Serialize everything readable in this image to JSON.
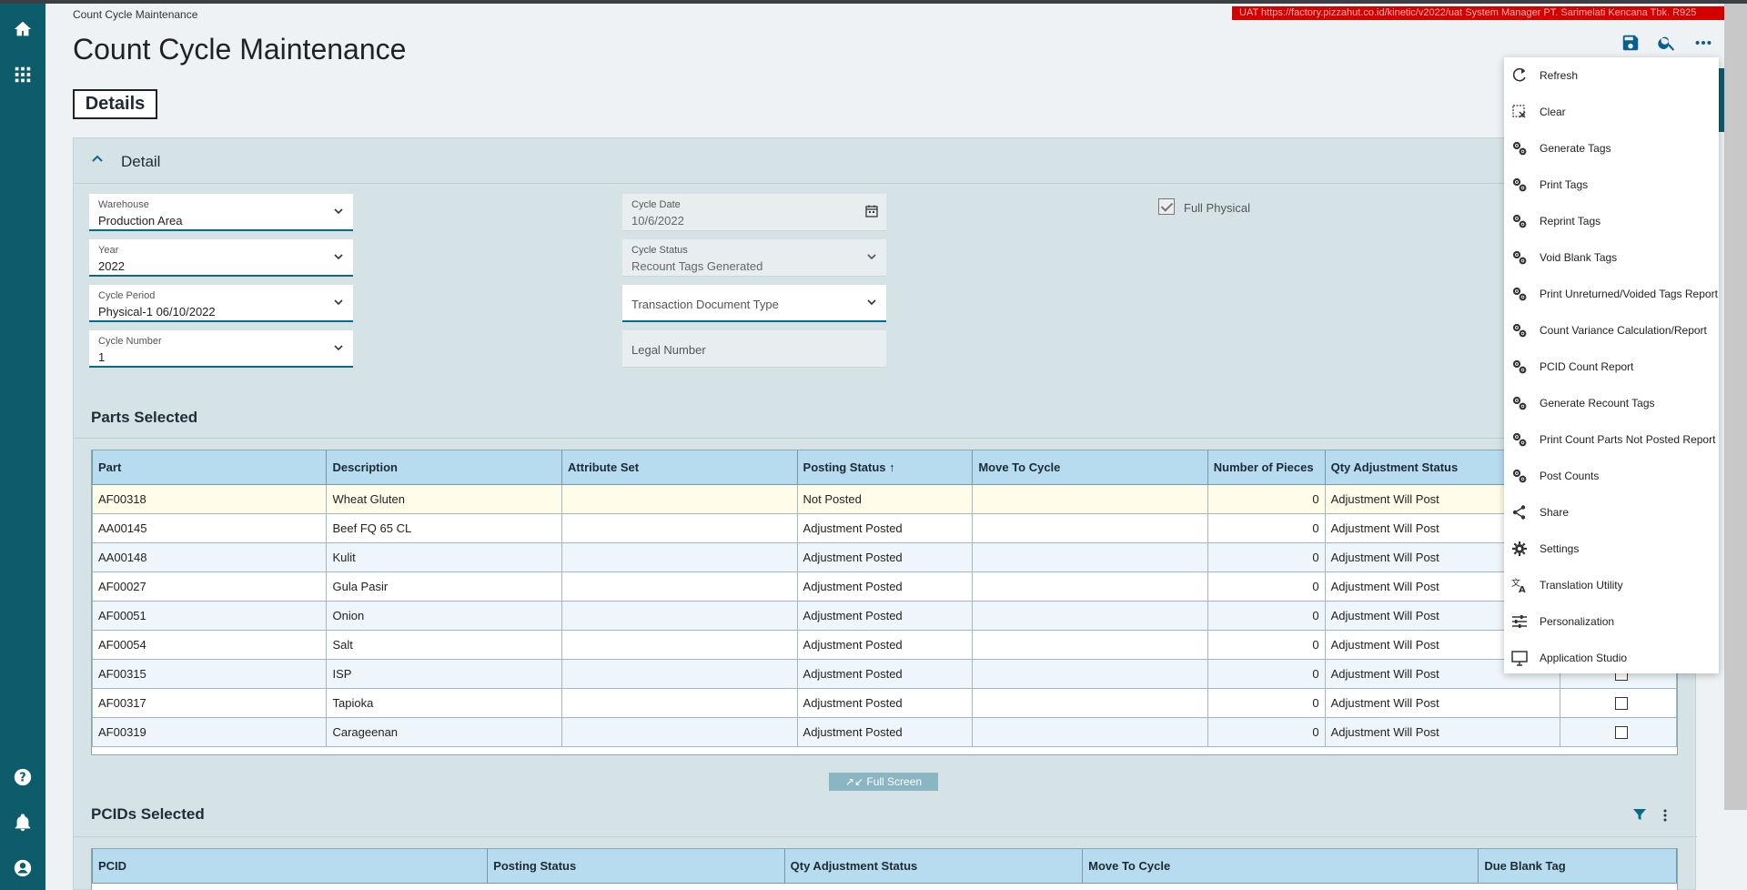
{
  "breadcrumb": "Count Cycle Maintenance",
  "env_banner": "UAT   https://factory.pizzahut.co.id/kinetic/v2022/uat   System Manager   PT. Sarimelati Kencana Tbk.   R925",
  "page_title": "Count Cycle Maintenance",
  "details_tab": "Details",
  "detail": {
    "title": "Detail",
    "warehouse": {
      "label": "Warehouse",
      "value": "Production Area"
    },
    "year": {
      "label": "Year",
      "value": "2022"
    },
    "cycle_period": {
      "label": "Cycle Period",
      "value": "Physical-1 06/10/2022"
    },
    "cycle_number": {
      "label": "Cycle Number",
      "value": "1"
    },
    "cycle_date": {
      "label": "Cycle Date",
      "value": "10/6/2022"
    },
    "cycle_status": {
      "label": "Cycle Status",
      "value": "Recount Tags Generated"
    },
    "transaction_doc_type": {
      "placeholder": "Transaction Document Type"
    },
    "legal_number": {
      "placeholder": "Legal Number"
    },
    "full_physical": {
      "label": "Full Physical",
      "checked": true
    }
  },
  "parts": {
    "title": "Parts Selected",
    "columns": [
      "Part",
      "Description",
      "Attribute Set",
      "Posting Status ↑",
      "Move To Cycle",
      "Number of Pieces",
      "Qty Adjustment Status",
      ""
    ],
    "rows": [
      [
        "AF00318",
        "Wheat Gluten",
        "",
        "Not Posted",
        "",
        "0",
        "Adjustment Will Post"
      ],
      [
        "AA00145",
        "Beef FQ 65 CL",
        "",
        "Adjustment Posted",
        "",
        "0",
        "Adjustment Will Post"
      ],
      [
        "AA00148",
        "Kulit",
        "",
        "Adjustment Posted",
        "",
        "0",
        "Adjustment Will Post"
      ],
      [
        "AF00027",
        "Gula Pasir",
        "",
        "Adjustment Posted",
        "",
        "0",
        "Adjustment Will Post"
      ],
      [
        "AF00051",
        "Onion",
        "",
        "Adjustment Posted",
        "",
        "0",
        "Adjustment Will Post"
      ],
      [
        "AF00054",
        "Salt",
        "",
        "Adjustment Posted",
        "",
        "0",
        "Adjustment Will Post"
      ],
      [
        "AF00315",
        "ISP",
        "",
        "Adjustment Posted",
        "",
        "0",
        "Adjustment Will Post"
      ],
      [
        "AF00317",
        "Tapioka",
        "",
        "Adjustment Posted",
        "",
        "0",
        "Adjustment Will Post"
      ],
      [
        "AF00319",
        "Carageenan",
        "",
        "Adjustment Posted",
        "",
        "0",
        "Adjustment Will Post"
      ]
    ]
  },
  "full_screen_label": "Full Screen",
  "pcids": {
    "title": "PCIDs Selected",
    "columns": [
      "PCID",
      "Posting Status",
      "Qty Adjustment Status",
      "Move To Cycle",
      "Due Blank Tag"
    ]
  },
  "menu": {
    "items": [
      {
        "label": "Refresh",
        "icon": "refresh-icon"
      },
      {
        "label": "Clear",
        "icon": "clear-icon"
      },
      {
        "label": "Generate Tags",
        "icon": "gears-icon"
      },
      {
        "label": "Print Tags",
        "icon": "gears-icon"
      },
      {
        "label": "Reprint Tags",
        "icon": "gears-icon"
      },
      {
        "label": "Void Blank Tags",
        "icon": "gears-icon"
      },
      {
        "label": "Print Unreturned/Voided Tags Report",
        "icon": "gears-icon"
      },
      {
        "label": "Count Variance Calculation/Report",
        "icon": "gears-icon"
      },
      {
        "label": "PCID Count Report",
        "icon": "gears-icon"
      },
      {
        "label": "Generate Recount Tags",
        "icon": "gears-icon"
      },
      {
        "label": "Print Count Parts Not Posted Report",
        "icon": "gears-icon"
      },
      {
        "label": "Post Counts",
        "icon": "gears-icon"
      },
      {
        "label": "Share",
        "icon": "share-icon"
      },
      {
        "label": "Settings",
        "icon": "settings-icon"
      },
      {
        "label": "Translation Utility",
        "icon": "translate-icon"
      },
      {
        "label": "Personalization",
        "icon": "sliders-icon"
      },
      {
        "label": "Application Studio",
        "icon": "monitor-icon"
      }
    ]
  },
  "colors": {
    "sidebar": "#0c5c6c",
    "accent": "#0a6a8a",
    "banner": "#d40000",
    "grid_header": "#b7dcef"
  }
}
